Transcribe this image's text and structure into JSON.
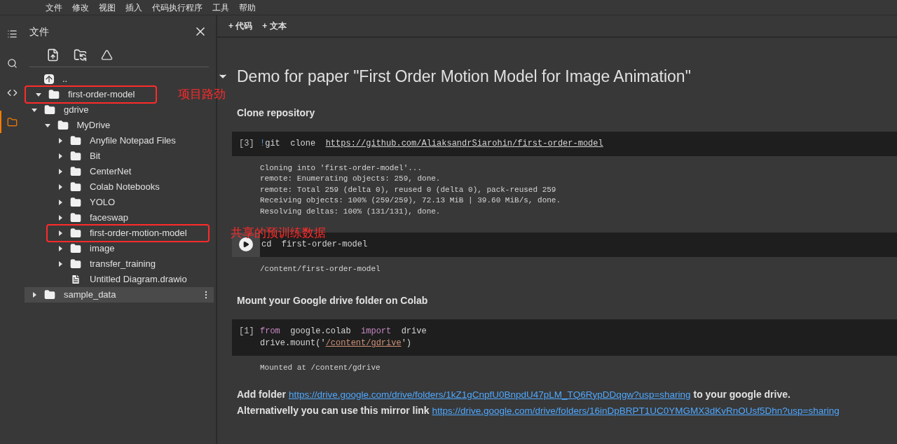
{
  "menu_bar": {
    "items": [
      "文件",
      "修改",
      "视图",
      "插入",
      "代码执行程序",
      "工具",
      "帮助"
    ]
  },
  "left_rail": {
    "items": [
      {
        "kind": "toc",
        "selected": false
      },
      {
        "kind": "search",
        "selected": false
      },
      {
        "kind": "code",
        "selected": false
      },
      {
        "kind": "files",
        "selected": true
      }
    ]
  },
  "sidebar": {
    "title": "文件",
    "tree": [
      {
        "kind": "up",
        "label": ".."
      },
      {
        "kind": "folder",
        "label": "first-order-model",
        "expanded": true,
        "selected": false,
        "annotation": "项目路劲"
      },
      {
        "kind": "folder",
        "label": "gdrive",
        "expanded": true,
        "selected": false,
        "children": [
          {
            "kind": "folder",
            "label": "MyDrive",
            "expanded": true,
            "selected": false,
            "children": [
              {
                "kind": "folder",
                "label": "Anyfile Notepad Files",
                "expanded": false,
                "selected": false
              },
              {
                "kind": "folder",
                "label": "Bit",
                "expanded": false,
                "selected": false
              },
              {
                "kind": "folder",
                "label": "CenterNet",
                "expanded": false,
                "selected": false
              },
              {
                "kind": "folder",
                "label": "Colab Notebooks",
                "expanded": false,
                "selected": false
              },
              {
                "kind": "folder",
                "label": "YOLO",
                "expanded": false,
                "selected": false
              },
              {
                "kind": "folder",
                "label": "faceswap",
                "expanded": false,
                "selected": false
              },
              {
                "kind": "folder",
                "label": "first-order-motion-model",
                "expanded": false,
                "selected": false,
                "annotation": "共享的预训练数据"
              },
              {
                "kind": "folder",
                "label": "image",
                "expanded": false,
                "selected": false
              },
              {
                "kind": "folder",
                "label": "transfer_training",
                "expanded": false,
                "selected": false
              },
              {
                "kind": "file",
                "label": "Untitled Diagram.drawio"
              }
            ]
          }
        ]
      },
      {
        "kind": "folder",
        "label": "sample_data",
        "expanded": false,
        "selected": true
      }
    ]
  },
  "toolbar": {
    "buttons": [
      "+ 代码",
      "+ 文本"
    ]
  },
  "notebook": [
    {
      "kind": "heading",
      "text": "Demo for paper \"First Order Motion Model for Image Animation\"",
      "expanded": true
    },
    {
      "kind": "section",
      "text": "Clone repository"
    },
    {
      "kind": "code",
      "prompt": "[3]",
      "lines": [
        [
          {
            "kind": "magic",
            "t": "!"
          },
          {
            "kind": "plain",
            "t": "git  clone  "
          },
          {
            "kind": "link",
            "t": "https://github.com/AliaksandrSiarohin/first-order-model"
          }
        ]
      ],
      "output": [
        "Cloning into 'first-order-model'...",
        "remote: Enumerating objects: 259, done.",
        "remote: Total 259 (delta 0), reused 0 (delta 0), pack-reused 259",
        "Receiving objects: 100% (259/259), 72.13 MiB | 39.60 MiB/s, done.",
        "Resolving deltas: 100% (131/131), done."
      ]
    },
    {
      "kind": "code",
      "lines": [
        [
          {
            "kind": "plain",
            "t": "cd  first-order-model"
          }
        ]
      ],
      "output": [
        "/content/first-order-model"
      ]
    },
    {
      "kind": "section",
      "text": "Mount your Google drive folder on Colab"
    },
    {
      "kind": "code",
      "prompt": "[1]",
      "lines": [
        [
          {
            "kind": "keyword",
            "t": "from"
          },
          {
            "kind": "plain",
            "t": "  google.colab  "
          },
          {
            "kind": "keyword",
            "t": "import"
          },
          {
            "kind": "plain",
            "t": "  drive"
          }
        ],
        [
          {
            "kind": "plain",
            "t": "drive.mount('"
          },
          {
            "kind": "string",
            "t": "/content/gdrive"
          },
          {
            "kind": "plain",
            "t": "')"
          }
        ]
      ],
      "output": [
        "Mounted at /content/gdrive"
      ]
    },
    {
      "kind": "paragraph",
      "parts": [
        {
          "kind": "text",
          "t": "Add folder "
        },
        {
          "kind": "link",
          "t": "https://drive.google.com/drive/folders/1kZ1gCnpfU0BnpdU47pLM_TQ6RypDDqgw?usp=sharing"
        },
        {
          "kind": "text",
          "t": " to your google drive."
        }
      ]
    },
    {
      "kind": "paragraph",
      "parts": [
        {
          "kind": "text",
          "t": "Alternativelly you can use this mirror link "
        },
        {
          "kind": "link",
          "t": "https://drive.google.com/drive/folders/16inDpBRPT1UC0YMGMX3dKvRnOUsf5Dhn?usp=sharing"
        }
      ]
    }
  ]
}
